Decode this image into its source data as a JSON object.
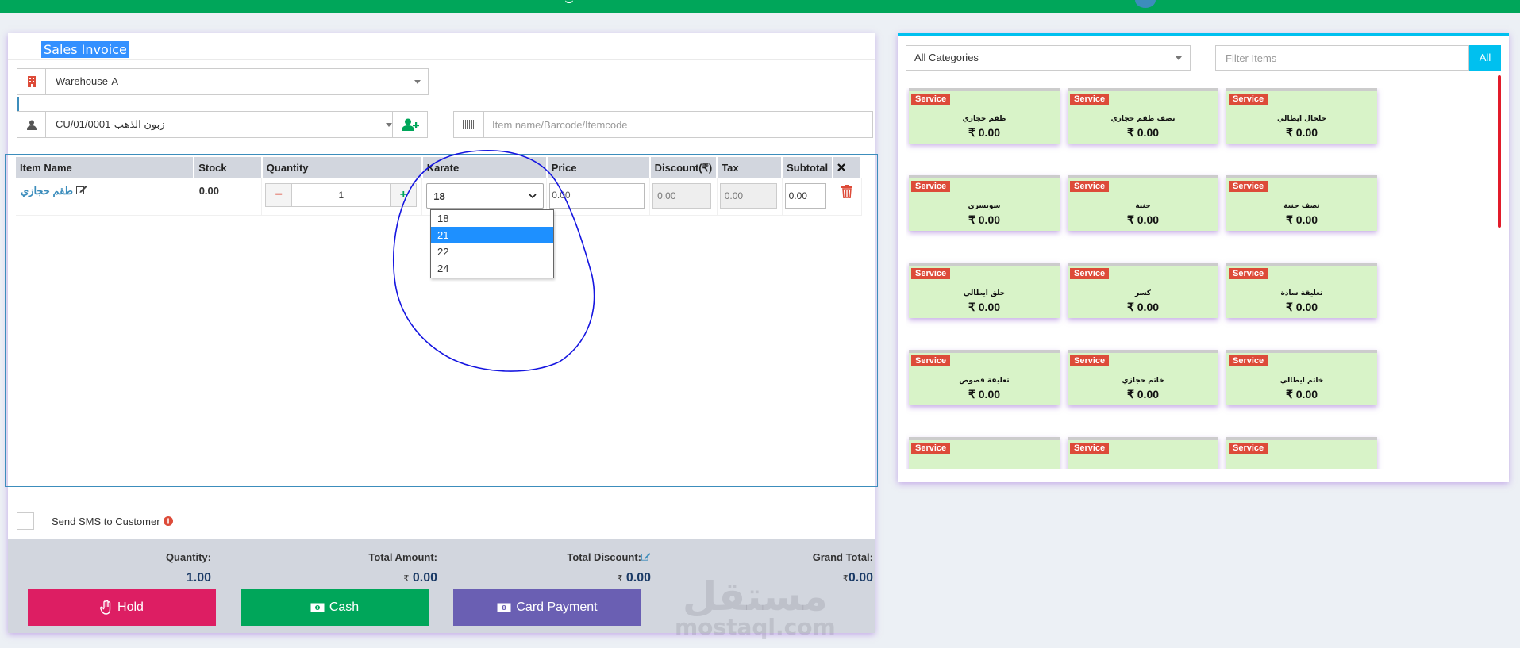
{
  "header": {
    "title": "Sales Invoice"
  },
  "warehouse": {
    "value": "Warehouse-A"
  },
  "customer": {
    "value": "CU/01/0001-زبون الذهب"
  },
  "item_search": {
    "placeholder": "Item name/Barcode/Itemcode"
  },
  "table": {
    "headers": [
      "Item Name",
      "Stock",
      "Quantity",
      "Karate",
      "Price",
      "Discount(₹)",
      "Tax",
      "Subtotal"
    ],
    "row": {
      "item_name": "طقم حجازي",
      "stock": "0.00",
      "quantity": "1",
      "karate": "18",
      "price": "0.00",
      "discount": "0.00",
      "tax": "0.00",
      "subtotal": "0.00"
    }
  },
  "karate_dropdown": {
    "options": [
      "18",
      "21",
      "22",
      "24"
    ],
    "highlighted": "21"
  },
  "sms": {
    "label": "Send SMS to Customer"
  },
  "summary": {
    "quantity_label": "Quantity:",
    "quantity_value": "1.00",
    "total_amount_label": "Total Amount:",
    "total_amount_value": "0.00",
    "total_discount_label": "Total Discount:",
    "total_discount_value": "0.00",
    "grand_total_label": "Grand Total:",
    "grand_total_value": "0.00",
    "currency": "₹"
  },
  "buttons": {
    "hold": "Hold",
    "cash": "Cash",
    "card": "Card Payment"
  },
  "watermark": {
    "arabic": "مستقل",
    "latin": "mostaql.com"
  },
  "right_panel": {
    "category": "All Categories",
    "filter_placeholder": "Filter Items",
    "all_button": "All"
  },
  "products": [
    {
      "badge": "Service",
      "name": "طقم حجازي",
      "price": "₹ 0.00"
    },
    {
      "badge": "Service",
      "name": "نصف طقم حجازي",
      "price": "₹ 0.00"
    },
    {
      "badge": "Service",
      "name": "خلخال ايطالي",
      "price": "₹ 0.00"
    },
    {
      "badge": "Service",
      "name": "سويسري",
      "price": "₹ 0.00"
    },
    {
      "badge": "Service",
      "name": "جنية",
      "price": "₹ 0.00"
    },
    {
      "badge": "Service",
      "name": "نصف جنية",
      "price": "₹ 0.00"
    },
    {
      "badge": "Service",
      "name": "حلق ايطالي",
      "price": "₹ 0.00"
    },
    {
      "badge": "Service",
      "name": "كسر",
      "price": "₹ 0.00"
    },
    {
      "badge": "Service",
      "name": "تعليقة سادة",
      "price": "₹ 0.00"
    },
    {
      "badge": "Service",
      "name": "تعليقة فصوص",
      "price": "₹ 0.00"
    },
    {
      "badge": "Service",
      "name": "خاتم حجازي",
      "price": "₹ 0.00"
    },
    {
      "badge": "Service",
      "name": "خاتم ايطالي",
      "price": "₹ 0.00"
    },
    {
      "badge": "Service",
      "name": "",
      "price": ""
    },
    {
      "badge": "Service",
      "name": "",
      "price": ""
    },
    {
      "badge": "Service",
      "name": "",
      "price": ""
    }
  ],
  "colors": {
    "topbar": "#00a65a",
    "hold": "#dd1e63",
    "cash": "#00a65a",
    "card": "#6a5fb3",
    "accent": "#00c0ef",
    "badge": "#dd4b39",
    "card_bg": "#d8f3c8"
  }
}
